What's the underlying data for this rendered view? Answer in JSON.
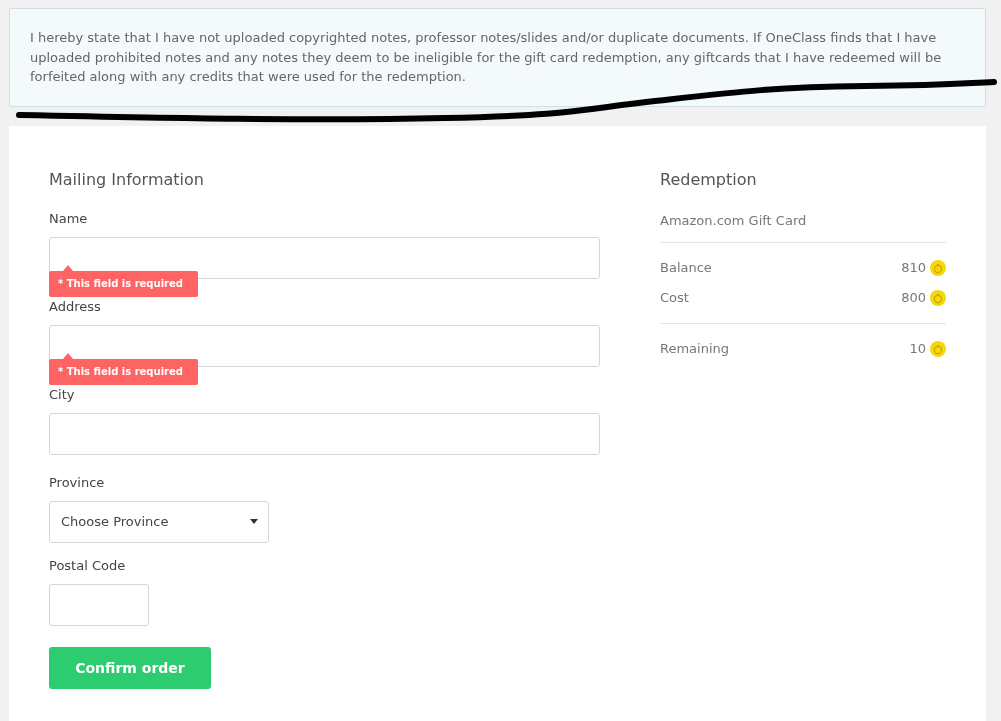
{
  "notice": {
    "text": "I hereby state that I have not uploaded copyrighted notes, professor notes/slides and/or duplicate documents. If OneClass finds that I have uploaded prohibited notes and any notes they deem to be ineligible for the gift card redemption, any giftcards that I have redeemed will be forfeited along with any credits that were used for the redemption."
  },
  "mailing": {
    "title": "Mailing Information",
    "fields": [
      {
        "kind": "text",
        "label": "Name",
        "error": "* This field is required"
      },
      {
        "kind": "text",
        "label": "Address",
        "error": "* This field is required"
      },
      {
        "kind": "text",
        "label": "City"
      },
      {
        "kind": "select",
        "label": "Province",
        "value": "Choose Province"
      },
      {
        "kind": "short",
        "label": "Postal Code"
      }
    ],
    "submit": "Confirm order"
  },
  "redemption": {
    "title": "Redemption",
    "item": "Amazon.com Gift Card",
    "rows": [
      {
        "label": "Balance",
        "value": "810"
      },
      {
        "label": "Cost",
        "value": "800"
      }
    ],
    "total": {
      "label": "Remaining",
      "value": "10"
    }
  }
}
